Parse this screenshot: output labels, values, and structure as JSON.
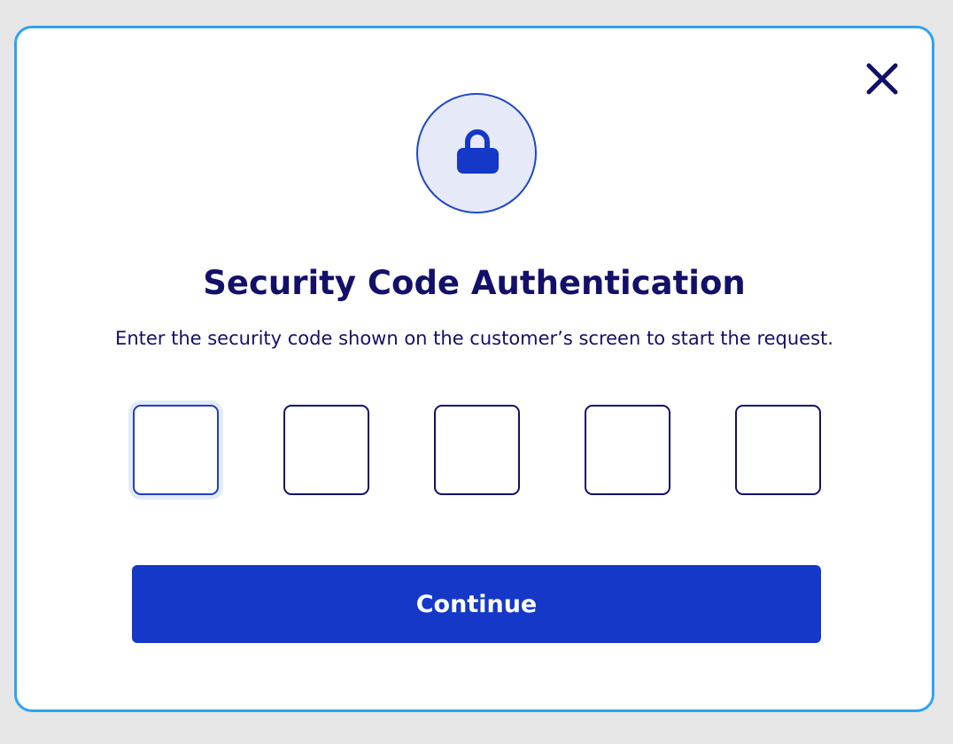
{
  "dialog": {
    "title": "Security Code Authentication",
    "subtitle": "Enter the security code shown on the customer’s screen to start the request.",
    "close_icon": "close-icon",
    "lock_icon": "lock-icon",
    "code_inputs": [
      {
        "value": "",
        "focused": true
      },
      {
        "value": "",
        "focused": false
      },
      {
        "value": "",
        "focused": false
      },
      {
        "value": "",
        "focused": false
      },
      {
        "value": "",
        "focused": false
      }
    ],
    "continue_label": "Continue"
  },
  "colors": {
    "accent": "#1538c8",
    "text": "#13106a",
    "border": "#2ea3f2",
    "lock_bg": "#e6e9f8"
  }
}
